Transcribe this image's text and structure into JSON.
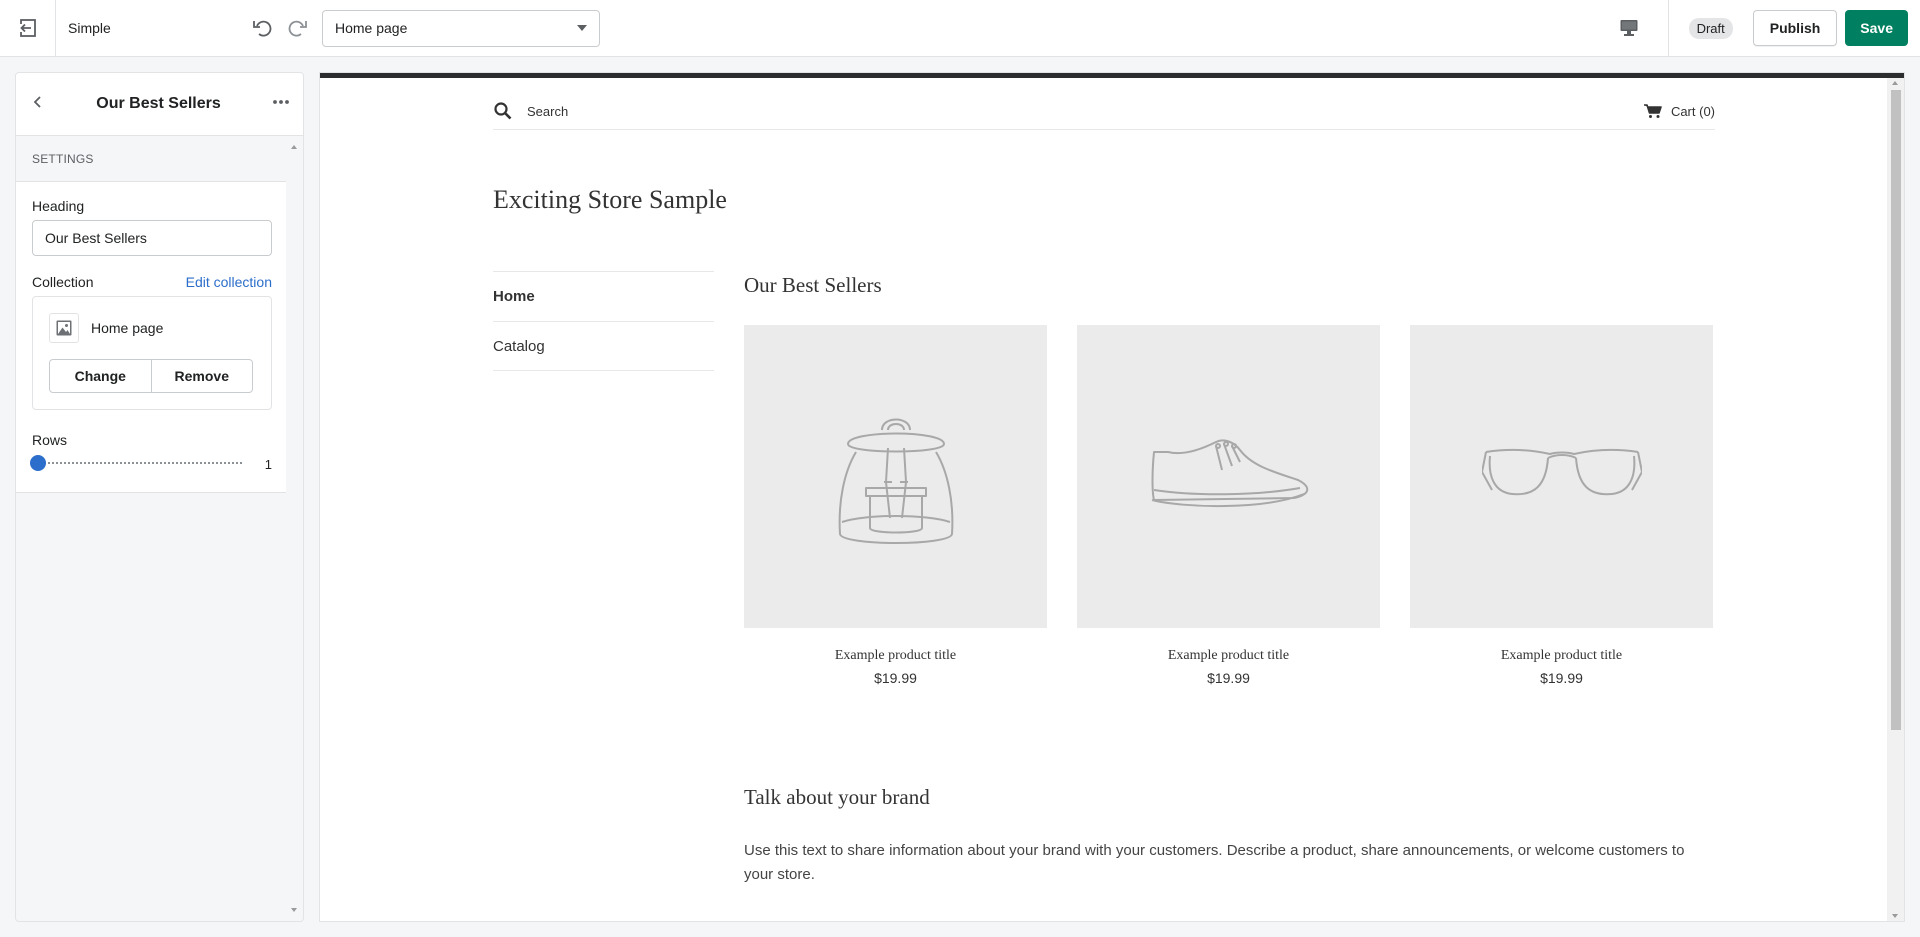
{
  "topbar": {
    "theme_name": "Simple",
    "page_select": "Home page",
    "draft_badge": "Draft",
    "publish_label": "Publish",
    "save_label": "Save",
    "save_color": "#008060"
  },
  "sidebar": {
    "title": "Our Best Sellers",
    "section_heading": "SETTINGS",
    "heading_label": "Heading",
    "heading_value": "Our Best Sellers",
    "collection_label": "Collection",
    "edit_collection_link": "Edit collection",
    "collection_name": "Home page",
    "change_label": "Change",
    "remove_label": "Remove",
    "rows_label": "Rows",
    "rows_value": "1"
  },
  "store": {
    "search_placeholder": "Search",
    "cart_label": "Cart (0)",
    "title": "Exciting Store Sample",
    "nav": [
      {
        "label": "Home",
        "active": true
      },
      {
        "label": "Catalog",
        "active": false
      }
    ],
    "featured_title": "Our Best Sellers",
    "products": [
      {
        "title": "Example product title",
        "price": "$19.99",
        "icon": "backpack-icon"
      },
      {
        "title": "Example product title",
        "price": "$19.99",
        "icon": "sneaker-icon"
      },
      {
        "title": "Example product title",
        "price": "$19.99",
        "icon": "glasses-icon"
      }
    ],
    "brand_title": "Talk about your brand",
    "brand_text": "Use this text to share information about your brand with your customers. Describe a product, share announcements, or welcome customers to your store."
  }
}
